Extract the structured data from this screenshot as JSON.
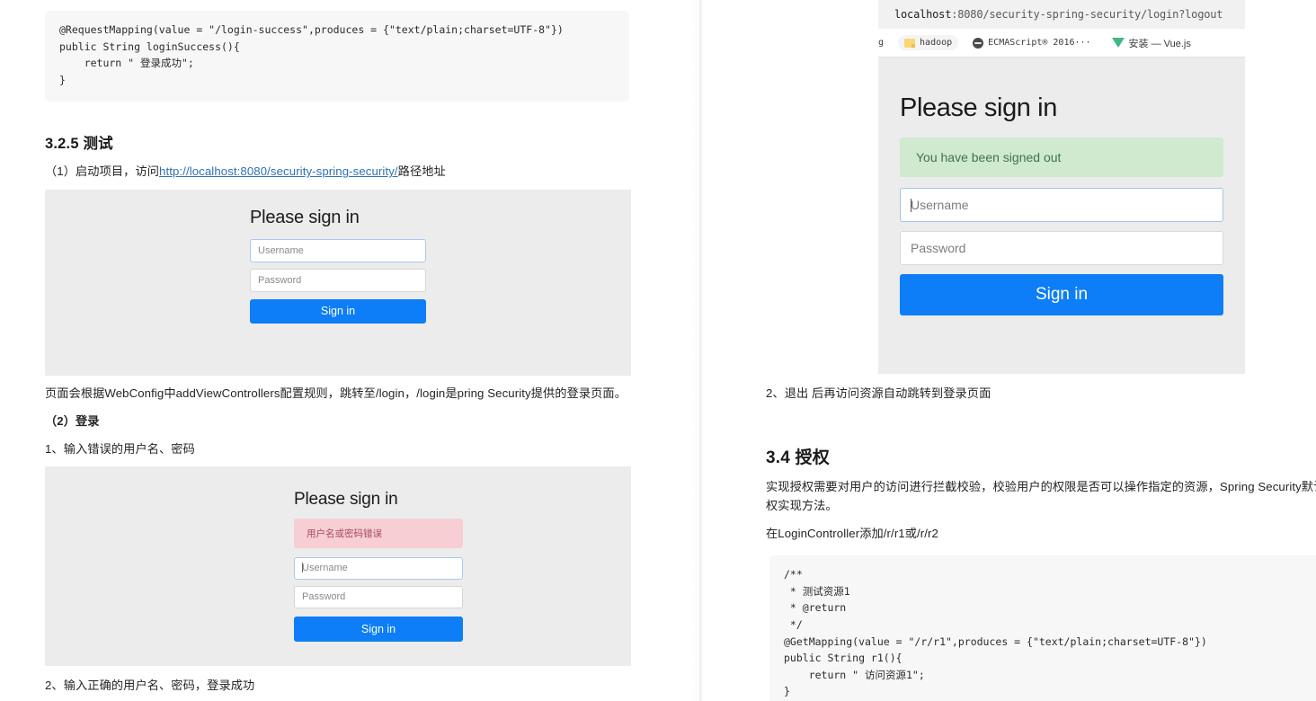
{
  "left": {
    "code_block_1": "@RequestMapping(value = \"/login-success\",produces = {\"text/plain;charset=UTF-8\"})\npublic String loginSuccess(){\n    return \" 登录成功\";\n}",
    "heading_325": "3.2.5 测试",
    "para_1_prefix": "（1）启动项目，访问",
    "para_1_link": "http://localhost:8080/security-spring-security/",
    "para_1_suffix": "路径地址",
    "login_form_1": {
      "title": "Please sign in",
      "username_placeholder": "Username",
      "password_placeholder": "Password",
      "signin_label": "Sign in"
    },
    "para_2": "页面会根据WebConfig中addViewControllers配置规则，跳转至/login，/login是pring Security提供的登录页面。",
    "heading_login": "（2）登录",
    "para_3": "1、输入错误的用户名、密码",
    "login_form_2": {
      "title": "Please sign in",
      "error_message": "用户名或密码错误",
      "username_placeholder": "Username",
      "password_placeholder": "Password",
      "signin_label": "Sign in"
    },
    "para_4": "2、输入正确的用户名、密码，登录成功"
  },
  "right": {
    "browser": {
      "url_host": "localhost",
      "url_path": ":8080/security-spring-security/login?logout",
      "bookmarks": [
        {
          "label": "g",
          "icon": "text-fragment"
        },
        {
          "label": "hadoop",
          "icon": "folder-icon"
        },
        {
          "label": "ECMAScript® 2016···",
          "icon": "globe-icon"
        },
        {
          "label": "安装 — Vue.js",
          "icon": "vue-icon"
        }
      ],
      "page": {
        "title": "Please sign in",
        "signed_out_message": "You have been signed out",
        "username_placeholder": "Username",
        "password_placeholder": "Password",
        "signin_label": "Sign in"
      }
    },
    "para_1": "2、退出 后再访问资源自动跳转到登录页面",
    "heading_34": "3.4 授权",
    "para_2": "实现授权需要对用户的访问进行拦截校验，校验用户的权限是否可以操作指定的资源，Spring Security默认",
    "para_2_line2": "权实现方法。",
    "para_3": "在LoginController添加/r/r1或/r/r2",
    "code_block_2": "/**\n * 测试资源1\n * @return\n */\n@GetMapping(value = \"/r/r1\",produces = {\"text/plain;charset=UTF-8\"})\npublic String r1(){\n    return \" 访问资源1\";\n}"
  },
  "colors": {
    "accent_blue": "#0d7ef7",
    "panel_gray": "#ececec",
    "code_bg": "#f7f7f8",
    "alert_danger_bg": "#f6ced4",
    "alert_success_bg": "#cfeacf",
    "link_blue": "#2f6fb5"
  }
}
